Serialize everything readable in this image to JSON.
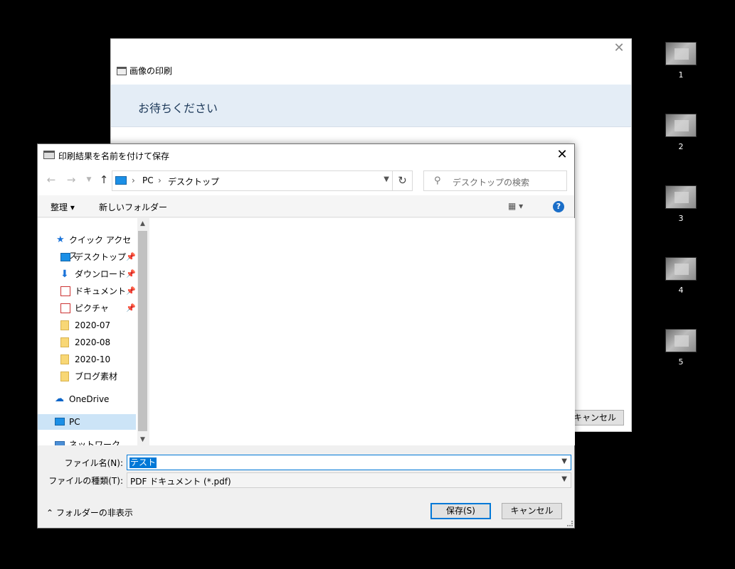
{
  "print_window": {
    "title": "画像の印刷",
    "wait_message": "お待ちください",
    "cancel_label": "キャンセル"
  },
  "thumbnails": [
    "1",
    "2",
    "3",
    "4",
    "5"
  ],
  "save_dialog": {
    "title": "印刷結果を名前を付けて保存",
    "breadcrumb": [
      "PC",
      "デスクトップ"
    ],
    "search_placeholder": "デスクトップの検索",
    "toolbar": {
      "organize": "整理 ▾",
      "new_folder": "新しいフォルダー"
    },
    "tree": {
      "quick_access": "クイック アクセス",
      "items": [
        "デスクトップ",
        "ダウンロード",
        "ドキュメント",
        "ピクチャ",
        "2020-07",
        "2020-08",
        "2020-10",
        "ブログ素材"
      ],
      "onedrive": "OneDrive",
      "pc": "PC",
      "network": "ネットワーク"
    },
    "filename_label": "ファイル名(N):",
    "filename_value": "テスト",
    "filetype_label": "ファイルの種類(T):",
    "filetype_value": "PDF ドキュメント (*.pdf)",
    "hide_folders": "フォルダーの非表示",
    "save_label": "保存(S)",
    "cancel_label": "キャンセル"
  },
  "colors": {
    "accent": "#0078d7",
    "selection": "#cce4f7",
    "wait_band": "#e4edf6"
  }
}
